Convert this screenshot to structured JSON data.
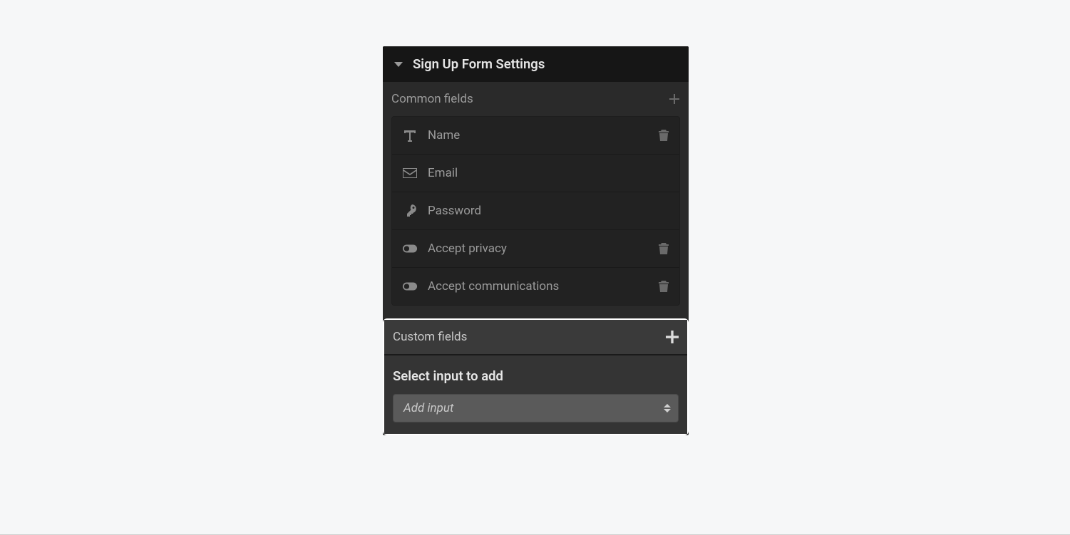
{
  "panel": {
    "title": "Sign Up Form Settings"
  },
  "common": {
    "title": "Common fields",
    "fields": [
      {
        "label": "Name",
        "icon": "text",
        "deletable": true
      },
      {
        "label": "Email",
        "icon": "mail",
        "deletable": false
      },
      {
        "label": "Password",
        "icon": "key",
        "deletable": false
      },
      {
        "label": "Accept privacy",
        "icon": "toggle",
        "deletable": true
      },
      {
        "label": "Accept communications",
        "icon": "toggle",
        "deletable": true
      }
    ]
  },
  "custom": {
    "title": "Custom fields",
    "form_label": "Select input to add",
    "select_placeholder": "Add input"
  }
}
